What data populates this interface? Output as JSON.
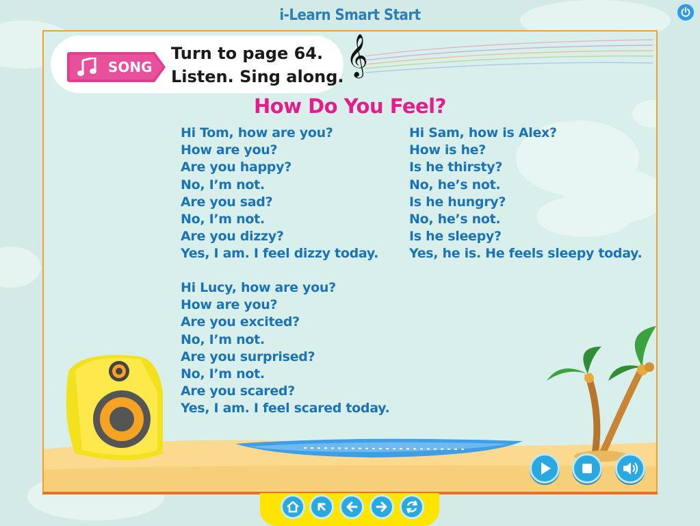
{
  "app": {
    "title": "i-Learn Smart Start"
  },
  "banner": {
    "tag_label": "SONG",
    "instruction_line1": "Turn to page 64.",
    "instruction_line2": "Listen. Sing along."
  },
  "song": {
    "title": "How Do You Feel?",
    "verse1": [
      "Hi Tom, how are you?",
      "How are you?",
      "Are you happy?",
      "No, I’m not.",
      "Are you sad?",
      "No, I’m not.",
      "Are you dizzy?",
      "Yes, I am. I feel dizzy today."
    ],
    "verse2": [
      "Hi Sam, how is Alex?",
      "How is he?",
      "Is he thirsty?",
      "No, he’s not.",
      "Is he hungry?",
      "No, he’s not.",
      "Is he sleepy?",
      "Yes, he is. He feels sleepy today."
    ],
    "verse3": [
      "Hi Lucy, how are you?",
      "How are you?",
      "Are you excited?",
      "No, I’m not.",
      "Are you surprised?",
      "No, I’m not.",
      "Are you scared?",
      "Yes, I am. I feel scared today."
    ]
  },
  "controls": {
    "play_icon": "play-icon",
    "stop_icon": "stop-icon",
    "audio_icon": "speaker-icon"
  },
  "nav": {
    "icons": [
      "home-icon",
      "back-arrow-icon",
      "previous-icon",
      "next-icon",
      "replay-icon"
    ]
  },
  "colors": {
    "title_pink": "#e51c8a",
    "lyric_blue": "#1b73b7",
    "button_blue": "#2aa8e0",
    "frame_orange": "#f0a02e"
  }
}
